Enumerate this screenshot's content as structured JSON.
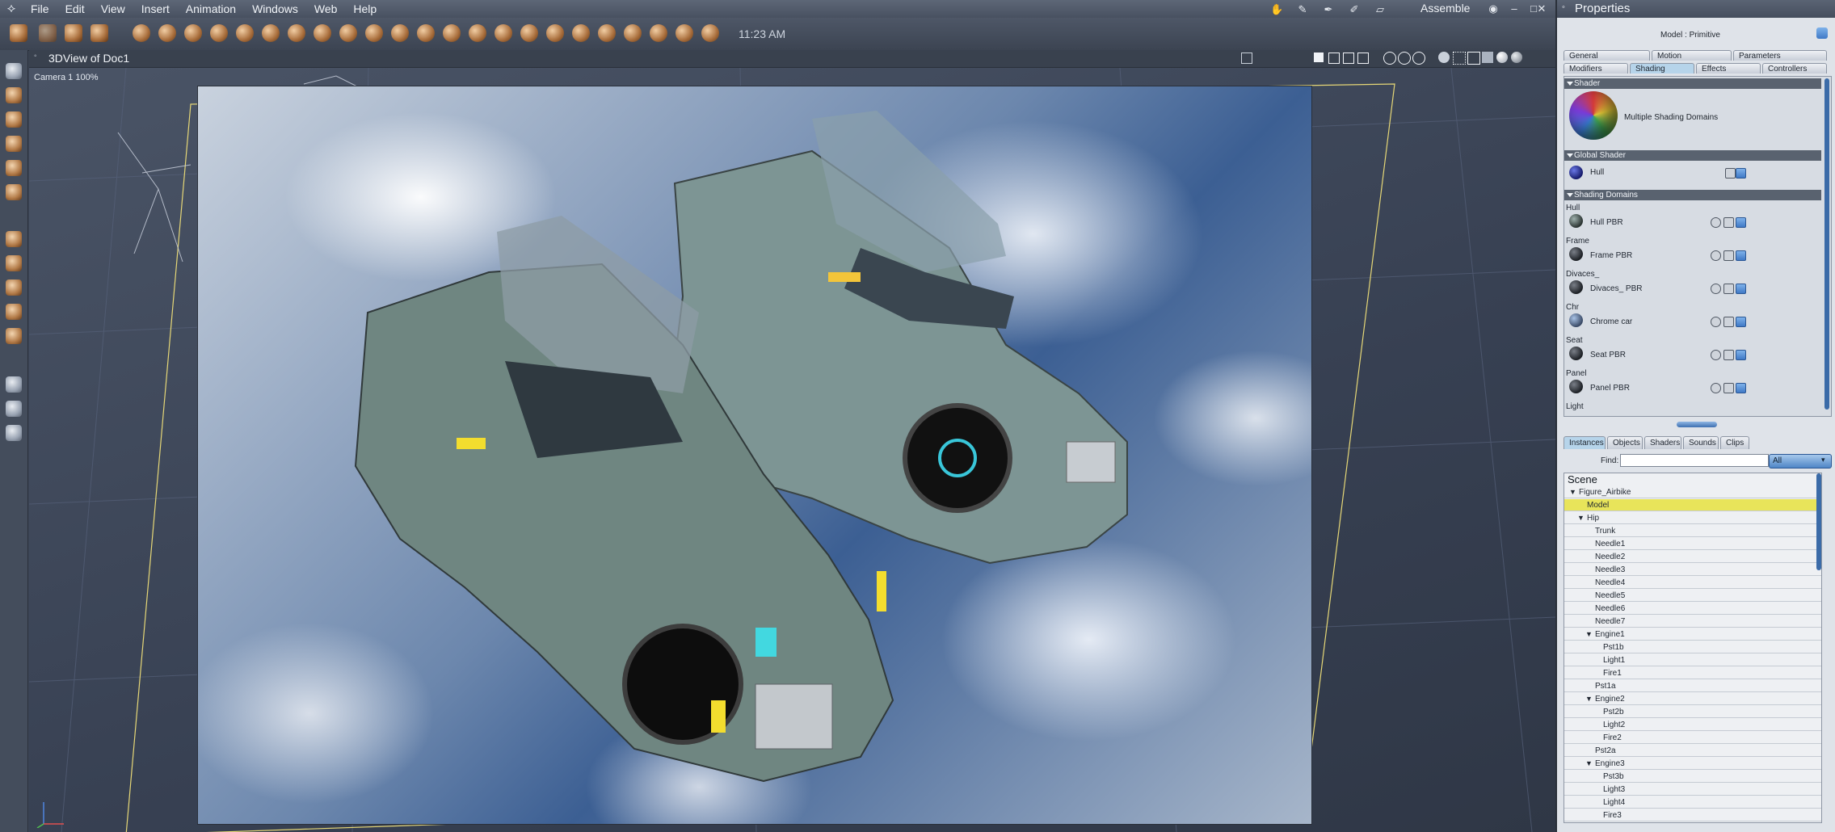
{
  "menubar": {
    "items": [
      "File",
      "Edit",
      "View",
      "Insert",
      "Animation",
      "Windows",
      "Web",
      "Help"
    ],
    "room": "Assemble"
  },
  "toolbar": {
    "clock": "11:23 AM"
  },
  "viewport": {
    "title": "3DView of Doc1",
    "camera": "Camera 1 100%"
  },
  "properties": {
    "title": "Properties",
    "model_label": "Model : Primitive",
    "tabs_row1": [
      "General",
      "Motion",
      "Parameters"
    ],
    "tabs_row2": [
      "Modifiers",
      "Shading",
      "Effects",
      "Controllers"
    ],
    "active_tab": "Shading",
    "shader_section": "Shader",
    "shader_label": "Multiple Shading Domains",
    "global_shader_section": "Global Shader",
    "global_shader": "Hull",
    "shading_domains_section": "Shading Domains",
    "domains": [
      {
        "label": "Hull",
        "shader": "Hull PBR"
      },
      {
        "label": "Frame",
        "shader": "Frame PBR"
      },
      {
        "label": "Divaces_",
        "shader": "Divaces_ PBR"
      },
      {
        "label": "Chr",
        "shader": "Chrome car"
      },
      {
        "label": "Seat",
        "shader": "Seat PBR"
      },
      {
        "label": "Panel",
        "shader": "Panel PBR"
      },
      {
        "label": "Light",
        "shader": ""
      }
    ]
  },
  "instances": {
    "tabs": [
      "Instances",
      "Objects",
      "Shaders",
      "Sounds",
      "Clips"
    ],
    "active_tab": "Instances",
    "find_label": "Find:",
    "find_value": "",
    "filter_value": "All",
    "tree_header": "Scene",
    "tree": [
      {
        "label": "Figure_Airbike",
        "depth": 0,
        "expanded": true
      },
      {
        "label": "Model",
        "depth": 1,
        "selected": true
      },
      {
        "label": "Hip",
        "depth": 1,
        "expanded": true
      },
      {
        "label": "Trunk",
        "depth": 2
      },
      {
        "label": "Needle1",
        "depth": 2
      },
      {
        "label": "Needle2",
        "depth": 2
      },
      {
        "label": "Needle3",
        "depth": 2
      },
      {
        "label": "Needle4",
        "depth": 2
      },
      {
        "label": "Needle5",
        "depth": 2
      },
      {
        "label": "Needle6",
        "depth": 2
      },
      {
        "label": "Needle7",
        "depth": 2
      },
      {
        "label": "Engine1",
        "depth": 2,
        "expanded": true
      },
      {
        "label": "Pst1b",
        "depth": 3
      },
      {
        "label": "Light1",
        "depth": 3
      },
      {
        "label": "Fire1",
        "depth": 3
      },
      {
        "label": "Pst1a",
        "depth": 2
      },
      {
        "label": "Engine2",
        "depth": 2,
        "expanded": true
      },
      {
        "label": "Pst2b",
        "depth": 3
      },
      {
        "label": "Light2",
        "depth": 3
      },
      {
        "label": "Fire2",
        "depth": 3
      },
      {
        "label": "Pst2a",
        "depth": 2
      },
      {
        "label": "Engine3",
        "depth": 2,
        "expanded": true
      },
      {
        "label": "Pst3b",
        "depth": 3
      },
      {
        "label": "Light3",
        "depth": 3
      },
      {
        "label": "Light4",
        "depth": 3
      },
      {
        "label": "Fire3",
        "depth": 3
      }
    ]
  }
}
